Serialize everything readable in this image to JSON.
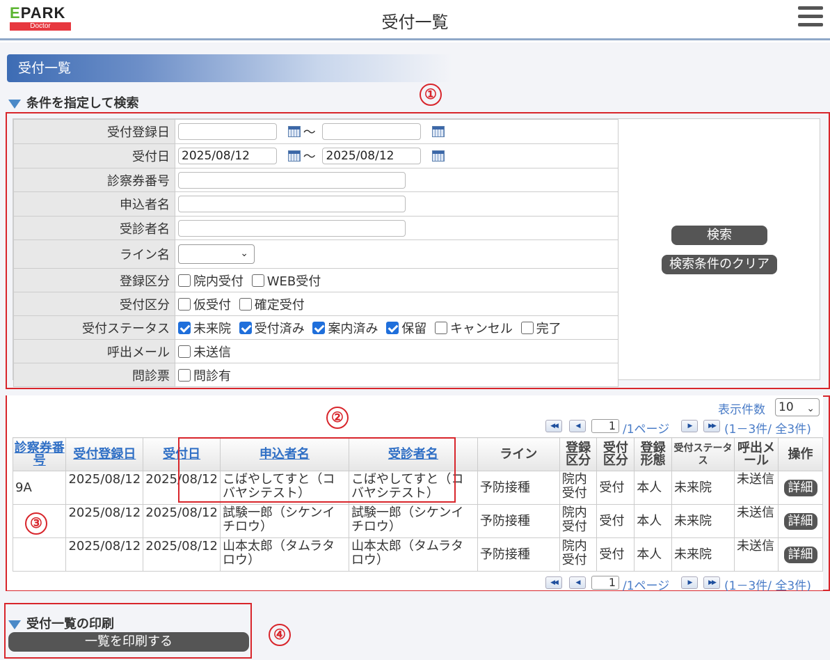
{
  "header": {
    "logo_main": "EPARK",
    "logo_sub": "Doctor",
    "title": "受付一覧",
    "menu_icon": "hamburger-menu-icon"
  },
  "section_title": "受付一覧",
  "search": {
    "heading": "条件を指定して検索",
    "annotation": "①",
    "fields": {
      "reg_date_label": "受付登録日",
      "reg_date_from": "",
      "reg_date_to": "",
      "tilde": "～",
      "recept_date_label": "受付日",
      "recept_date_from": "2025/08/12",
      "recept_date_to": "2025/08/12",
      "card_no_label": "診察券番号",
      "applicant_label": "申込者名",
      "patient_label": "受診者名",
      "line_label": "ライン名",
      "reg_type_label": "登録区分",
      "reg_type_options": [
        {
          "label": "院内受付",
          "checked": false
        },
        {
          "label": "WEB受付",
          "checked": false
        }
      ],
      "recept_type_label": "受付区分",
      "recept_type_options": [
        {
          "label": "仮受付",
          "checked": false
        },
        {
          "label": "確定受付",
          "checked": false
        }
      ],
      "status_label": "受付ステータス",
      "status_options": [
        {
          "label": "未来院",
          "checked": true
        },
        {
          "label": "受付済み",
          "checked": true
        },
        {
          "label": "案内済み",
          "checked": true
        },
        {
          "label": "保留",
          "checked": true
        },
        {
          "label": "キャンセル",
          "checked": false
        },
        {
          "label": "完了",
          "checked": false
        }
      ],
      "call_mail_label": "呼出メール",
      "call_mail_option": "未送信",
      "questionnaire_label": "問診票",
      "questionnaire_option": "問診有"
    },
    "search_button": "検索",
    "clear_button": "検索条件のクリア"
  },
  "results": {
    "annotation_table": "②",
    "annotation_rows": "③",
    "per_page_label": "表示件数",
    "per_page_value": "10",
    "pager": {
      "page": "1",
      "pages_text": "/1ページ",
      "count_text": "(1－3件/ 全3件)"
    },
    "columns": {
      "card_no": "診察券番号",
      "reg_date": "受付登録日",
      "recept_date": "受付日",
      "applicant": "申込者名",
      "patient": "受診者名",
      "line": "ライン",
      "reg_type": "登録区分",
      "recept_type": "受付区分",
      "reg_form": "登録形態",
      "status": "受付ステータス",
      "call_mail": "呼出メール",
      "action": "操作"
    },
    "rows": [
      {
        "card_no": "9A",
        "reg_date": "2025/08/12",
        "recept_date": "2025/08/12",
        "applicant": "こばやしてすと（コバヤシテスト）",
        "patient": "こばやしてすと（コバヤシテスト）",
        "line": "予防接種",
        "reg_type": "院内受付",
        "recept_type": "受付",
        "reg_form": "本人",
        "status": "未来院",
        "call_mail": "未送信",
        "action": "詳細"
      },
      {
        "card_no": "",
        "reg_date": "2025/08/12",
        "recept_date": "2025/08/12",
        "applicant": "試験一郎（シケンイチロウ）",
        "patient": "試験一郎（シケンイチロウ）",
        "line": "予防接種",
        "reg_type": "院内受付",
        "recept_type": "受付",
        "reg_form": "本人",
        "status": "未来院",
        "call_mail": "未送信",
        "action": "詳細"
      },
      {
        "card_no": "",
        "reg_date": "2025/08/12",
        "recept_date": "2025/08/12",
        "applicant": "山本太郎（タムラタロウ）",
        "patient": "山本太郎（タムラタロウ）",
        "line": "予防接種",
        "reg_type": "院内受付",
        "recept_type": "受付",
        "reg_form": "本人",
        "status": "未来院",
        "call_mail": "未送信",
        "action": "詳細"
      }
    ]
  },
  "print": {
    "heading": "受付一覧の印刷",
    "button": "一覧を印刷する",
    "annotation": "④"
  },
  "colors": {
    "accent": "#3d6cb4",
    "annotation": "#d8252b",
    "link": "#2f6fc5"
  }
}
